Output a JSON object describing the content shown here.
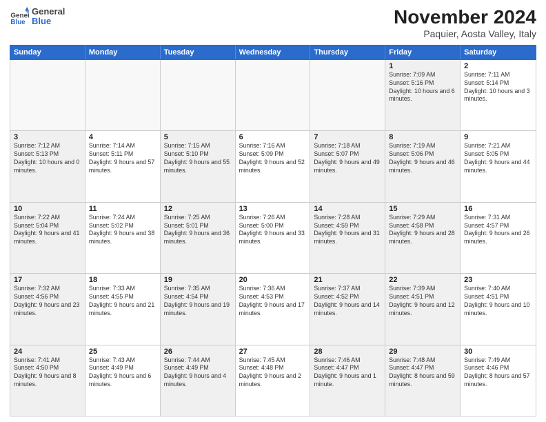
{
  "header": {
    "logo": {
      "general": "General",
      "blue": "Blue"
    },
    "month_title": "November 2024",
    "location": "Paquier, Aosta Valley, Italy"
  },
  "weekdays": [
    "Sunday",
    "Monday",
    "Tuesday",
    "Wednesday",
    "Thursday",
    "Friday",
    "Saturday"
  ],
  "rows": [
    [
      {
        "day": "",
        "info": "",
        "empty": true
      },
      {
        "day": "",
        "info": "",
        "empty": true
      },
      {
        "day": "",
        "info": "",
        "empty": true
      },
      {
        "day": "",
        "info": "",
        "empty": true
      },
      {
        "day": "",
        "info": "",
        "empty": true
      },
      {
        "day": "1",
        "info": "Sunrise: 7:09 AM\nSunset: 5:16 PM\nDaylight: 10 hours and 6 minutes.",
        "shaded": true
      },
      {
        "day": "2",
        "info": "Sunrise: 7:11 AM\nSunset: 5:14 PM\nDaylight: 10 hours and 3 minutes.",
        "shaded": false
      }
    ],
    [
      {
        "day": "3",
        "info": "Sunrise: 7:12 AM\nSunset: 5:13 PM\nDaylight: 10 hours and 0 minutes.",
        "shaded": true
      },
      {
        "day": "4",
        "info": "Sunrise: 7:14 AM\nSunset: 5:11 PM\nDaylight: 9 hours and 57 minutes.",
        "shaded": false
      },
      {
        "day": "5",
        "info": "Sunrise: 7:15 AM\nSunset: 5:10 PM\nDaylight: 9 hours and 55 minutes.",
        "shaded": true
      },
      {
        "day": "6",
        "info": "Sunrise: 7:16 AM\nSunset: 5:09 PM\nDaylight: 9 hours and 52 minutes.",
        "shaded": false
      },
      {
        "day": "7",
        "info": "Sunrise: 7:18 AM\nSunset: 5:07 PM\nDaylight: 9 hours and 49 minutes.",
        "shaded": true
      },
      {
        "day": "8",
        "info": "Sunrise: 7:19 AM\nSunset: 5:06 PM\nDaylight: 9 hours and 46 minutes.",
        "shaded": true
      },
      {
        "day": "9",
        "info": "Sunrise: 7:21 AM\nSunset: 5:05 PM\nDaylight: 9 hours and 44 minutes.",
        "shaded": false
      }
    ],
    [
      {
        "day": "10",
        "info": "Sunrise: 7:22 AM\nSunset: 5:04 PM\nDaylight: 9 hours and 41 minutes.",
        "shaded": true
      },
      {
        "day": "11",
        "info": "Sunrise: 7:24 AM\nSunset: 5:02 PM\nDaylight: 9 hours and 38 minutes.",
        "shaded": false
      },
      {
        "day": "12",
        "info": "Sunrise: 7:25 AM\nSunset: 5:01 PM\nDaylight: 9 hours and 36 minutes.",
        "shaded": true
      },
      {
        "day": "13",
        "info": "Sunrise: 7:26 AM\nSunset: 5:00 PM\nDaylight: 9 hours and 33 minutes.",
        "shaded": false
      },
      {
        "day": "14",
        "info": "Sunrise: 7:28 AM\nSunset: 4:59 PM\nDaylight: 9 hours and 31 minutes.",
        "shaded": true
      },
      {
        "day": "15",
        "info": "Sunrise: 7:29 AM\nSunset: 4:58 PM\nDaylight: 9 hours and 28 minutes.",
        "shaded": true
      },
      {
        "day": "16",
        "info": "Sunrise: 7:31 AM\nSunset: 4:57 PM\nDaylight: 9 hours and 26 minutes.",
        "shaded": false
      }
    ],
    [
      {
        "day": "17",
        "info": "Sunrise: 7:32 AM\nSunset: 4:56 PM\nDaylight: 9 hours and 23 minutes.",
        "shaded": true
      },
      {
        "day": "18",
        "info": "Sunrise: 7:33 AM\nSunset: 4:55 PM\nDaylight: 9 hours and 21 minutes.",
        "shaded": false
      },
      {
        "day": "19",
        "info": "Sunrise: 7:35 AM\nSunset: 4:54 PM\nDaylight: 9 hours and 19 minutes.",
        "shaded": true
      },
      {
        "day": "20",
        "info": "Sunrise: 7:36 AM\nSunset: 4:53 PM\nDaylight: 9 hours and 17 minutes.",
        "shaded": false
      },
      {
        "day": "21",
        "info": "Sunrise: 7:37 AM\nSunset: 4:52 PM\nDaylight: 9 hours and 14 minutes.",
        "shaded": true
      },
      {
        "day": "22",
        "info": "Sunrise: 7:39 AM\nSunset: 4:51 PM\nDaylight: 9 hours and 12 minutes.",
        "shaded": true
      },
      {
        "day": "23",
        "info": "Sunrise: 7:40 AM\nSunset: 4:51 PM\nDaylight: 9 hours and 10 minutes.",
        "shaded": false
      }
    ],
    [
      {
        "day": "24",
        "info": "Sunrise: 7:41 AM\nSunset: 4:50 PM\nDaylight: 9 hours and 8 minutes.",
        "shaded": true
      },
      {
        "day": "25",
        "info": "Sunrise: 7:43 AM\nSunset: 4:49 PM\nDaylight: 9 hours and 6 minutes.",
        "shaded": false
      },
      {
        "day": "26",
        "info": "Sunrise: 7:44 AM\nSunset: 4:49 PM\nDaylight: 9 hours and 4 minutes.",
        "shaded": true
      },
      {
        "day": "27",
        "info": "Sunrise: 7:45 AM\nSunset: 4:48 PM\nDaylight: 9 hours and 2 minutes.",
        "shaded": false
      },
      {
        "day": "28",
        "info": "Sunrise: 7:46 AM\nSunset: 4:47 PM\nDaylight: 9 hours and 1 minute.",
        "shaded": true
      },
      {
        "day": "29",
        "info": "Sunrise: 7:48 AM\nSunset: 4:47 PM\nDaylight: 8 hours and 59 minutes.",
        "shaded": true
      },
      {
        "day": "30",
        "info": "Sunrise: 7:49 AM\nSunset: 4:46 PM\nDaylight: 8 hours and 57 minutes.",
        "shaded": false
      }
    ]
  ]
}
